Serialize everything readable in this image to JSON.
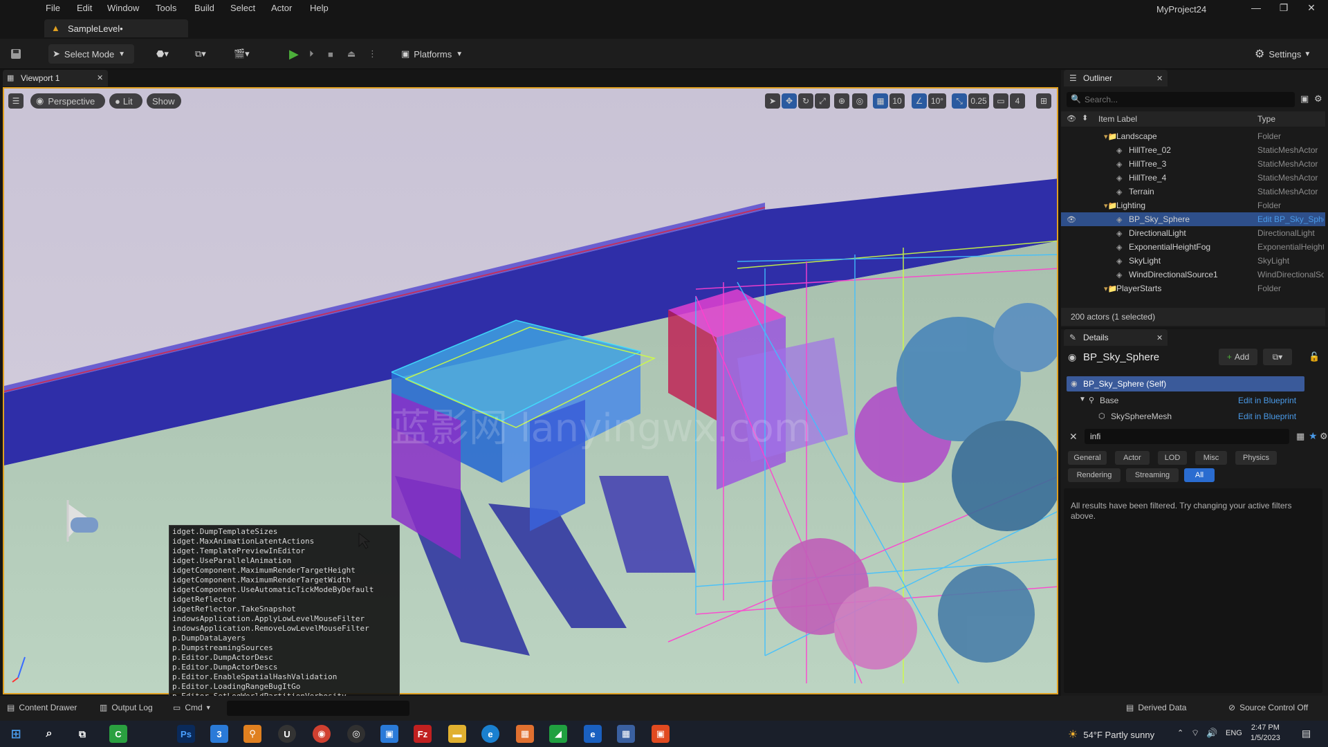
{
  "menu": {
    "items": [
      "File",
      "Edit",
      "Window",
      "Tools",
      "Build",
      "Select",
      "Actor",
      "Help"
    ],
    "project": "MyProject24"
  },
  "level_tab": {
    "label": "SampleLevel•"
  },
  "toolbar": {
    "select_mode": "Select Mode",
    "platforms": "Platforms",
    "settings": "Settings"
  },
  "viewport": {
    "tab_label": "Viewport 1",
    "perspective": "Perspective",
    "lit": "Lit",
    "show": "Show",
    "grid_snap": "10",
    "rotation_snap": "10°",
    "scale_snap": "0.25",
    "camera_speed": "4",
    "watermark": "蓝影网 lanyingwx.com"
  },
  "console": {
    "lines": [
      "idget.DumpTemplateSizes",
      "idget.MaxAnimationLatentActions",
      "idget.TemplatePreviewInEditor",
      "idget.UseParallelAnimation",
      "idgetComponent.MaximumRenderTargetHeight",
      "idgetComponent.MaximumRenderTargetWidth",
      "idgetComponent.UseAutomaticTickModeByDefault",
      "idgetReflector",
      "idgetReflector.TakeSnapshot",
      "indowsApplication.ApplyLowLevelMouseFilter",
      "indowsApplication.RemoveLowLevelMouseFilter",
      "p.DumpDataLayers",
      "p.DumpstreamingSources",
      "p.Editor.DumpActorDesc",
      "p.Editor.DumpActorDescs",
      "p.Editor.EnableSpatialHashValidation",
      "p.Editor.LoadingRangeBugItGo",
      "p.Editor.SetLogWorldPartitionVerbosity"
    ]
  },
  "outliner": {
    "title": "Outliner",
    "search_placeholder": "Search...",
    "col_label": "Item Label",
    "col_type": "Type",
    "rows": [
      {
        "label": "Landscape",
        "type": "Folder"
      },
      {
        "label": "HillTree_02",
        "type": "StaticMeshActor"
      },
      {
        "label": "HillTree_3",
        "type": "StaticMeshActor"
      },
      {
        "label": "HillTree_4",
        "type": "StaticMeshActor"
      },
      {
        "label": "Terrain",
        "type": "StaticMeshActor"
      },
      {
        "label": "Lighting",
        "type": "Folder"
      },
      {
        "label": "BP_Sky_Sphere",
        "type": "Edit BP_Sky_Sphere"
      },
      {
        "label": "DirectionalLight",
        "type": "DirectionalLight"
      },
      {
        "label": "ExponentialHeightFog",
        "type": "ExponentialHeightFog"
      },
      {
        "label": "SkyLight",
        "type": "SkyLight"
      },
      {
        "label": "WindDirectionalSource1",
        "type": "WindDirectionalSource"
      },
      {
        "label": "PlayerStarts",
        "type": "Folder"
      }
    ],
    "status": "200 actors (1 selected)"
  },
  "details": {
    "title": "Details",
    "actor_name": "BP_Sky_Sphere",
    "add_label": "Add",
    "self_label": "BP_Sky_Sphere (Self)",
    "base_label": "Base",
    "mesh_label": "SkySphereMesh",
    "edit_bp": "Edit in Blueprint",
    "search_value": "infi",
    "filters": [
      "General",
      "Actor",
      "LOD",
      "Misc",
      "Physics",
      "Rendering",
      "Streaming",
      "All"
    ],
    "empty_msg": "All results have been filtered. Try changing your active filters above."
  },
  "bottombar": {
    "content_drawer": "Content Drawer",
    "output_log": "Output Log",
    "cmd": "Cmd",
    "derived_data": "Derived Data",
    "source_control": "Source Control Off"
  },
  "taskbar": {
    "weather": "54°F  Partly sunny",
    "lang": "ENG",
    "time": "2:47 PM",
    "date": "1/5/2023"
  }
}
